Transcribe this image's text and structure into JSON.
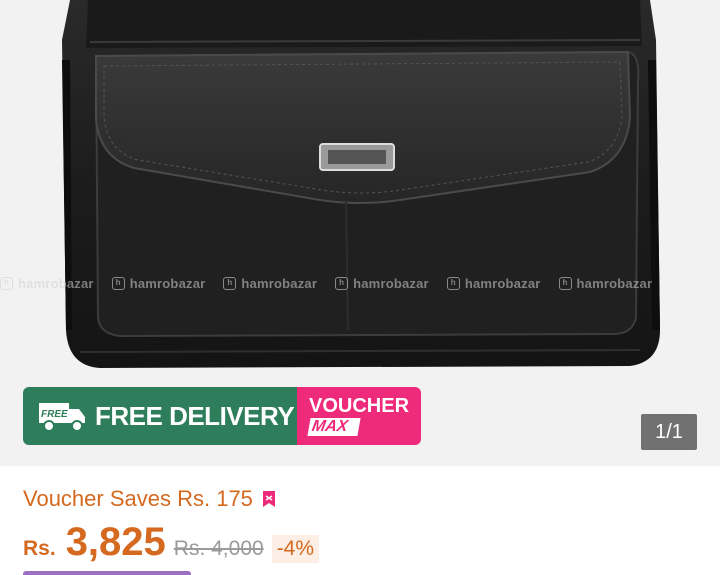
{
  "gallery": {
    "watermark_text": "hamrobazar",
    "counter": "1/1"
  },
  "banner": {
    "free_delivery": "FREE DELIVERY",
    "truck_label": "FREE",
    "voucher": "VOUCHER",
    "max": "MAX"
  },
  "product": {
    "voucher_saves": "Voucher Saves Rs. 175",
    "currency": "Rs.",
    "price": "3,825",
    "old_price": "Rs. 4,000",
    "discount": "-4%"
  },
  "colors": {
    "accent": "#d4691f",
    "free_delivery_green": "#2e7d5b",
    "voucher_pink": "#ee2a7b"
  }
}
